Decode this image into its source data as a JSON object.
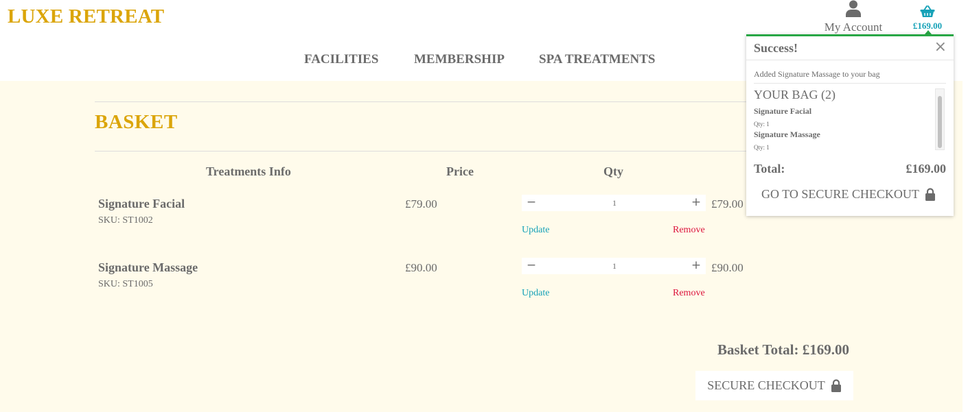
{
  "brand": {
    "logo": "LUXE RETREAT",
    "accent": "#dba50a",
    "link": "#17a2b8",
    "danger": "#dc143c",
    "success": "#28a745"
  },
  "nav": [
    {
      "label": "FACILITIES"
    },
    {
      "label": "MEMBERSHIP"
    },
    {
      "label": "SPA TREATMENTS"
    }
  ],
  "header": {
    "account_label": "My Account",
    "account_icon": "user-icon",
    "bag_icon": "basket-icon",
    "bag_total": "£169.00"
  },
  "basket": {
    "title": "BASKET",
    "columns": {
      "info": "Treatments Info",
      "price": "Price",
      "qty": "Qty"
    },
    "items": [
      {
        "name": "Signature Facial",
        "sku": "SKU: ST1002",
        "price": "£79.00",
        "qty": "1",
        "subtotal": "£79.00",
        "update": "Update",
        "remove": "Remove"
      },
      {
        "name": "Signature Massage",
        "sku": "SKU: ST1005",
        "price": "£90.00",
        "qty": "1",
        "subtotal": "£90.00",
        "update": "Update",
        "remove": "Remove"
      }
    ],
    "qty_minus": "−",
    "qty_plus": "+",
    "total": "Basket Total: £169.00",
    "checkout": "SECURE CHECKOUT"
  },
  "toast": {
    "title": "Success!",
    "close": "×",
    "message": "Added Signature Massage to your bag",
    "bag_title": "YOUR BAG (2)",
    "items": [
      {
        "name": "Signature Facial",
        "qty": "Qty: 1"
      },
      {
        "name": "Signature Massage",
        "qty": "Qty: 1"
      }
    ],
    "total_label": "Total:",
    "total_value": "£169.00",
    "checkout": "GO TO SECURE CHECKOUT"
  }
}
